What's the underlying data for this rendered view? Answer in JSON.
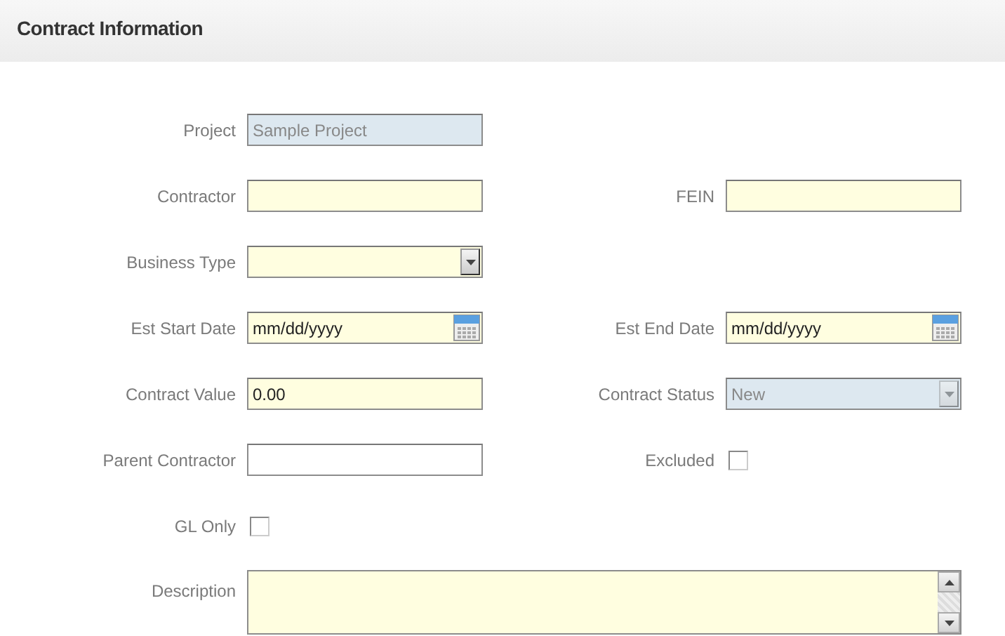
{
  "section": {
    "title": "Contract Information"
  },
  "rows": [
    {
      "left": {
        "label": "Project",
        "kind": "text",
        "value": "Sample Project",
        "required": false,
        "readonly": true
      }
    },
    {
      "left": {
        "label": "Contractor",
        "kind": "text",
        "required": true,
        "readonly": false
      },
      "right": {
        "label": "FEIN",
        "kind": "text",
        "required": true,
        "readonly": false
      }
    },
    {
      "left": {
        "label": "Business Type",
        "kind": "select",
        "required": true,
        "readonly": false
      }
    },
    {
      "left": {
        "label": "Est Start Date",
        "kind": "date",
        "value": "mm/dd/yyyy",
        "required": true,
        "readonly": false
      },
      "right": {
        "label": "Est End Date",
        "kind": "date",
        "value": "mm/dd/yyyy",
        "required": true,
        "readonly": false
      }
    },
    {
      "left": {
        "label": "Contract Value",
        "kind": "text",
        "value": "0.00",
        "required": true,
        "readonly": false
      },
      "right": {
        "label": "Contract Status",
        "kind": "select",
        "value": "New",
        "required": false,
        "readonly": true
      }
    },
    {
      "left": {
        "label": "Parent Contractor",
        "kind": "text",
        "required": false,
        "readonly": false
      },
      "right": {
        "label": "Excluded",
        "kind": "checkbox",
        "checked": false
      }
    },
    {
      "left": {
        "label": "GL Only",
        "kind": "checkbox",
        "checked": false
      }
    },
    {
      "left": {
        "label": "Description",
        "kind": "textarea",
        "required": true
      }
    }
  ]
}
